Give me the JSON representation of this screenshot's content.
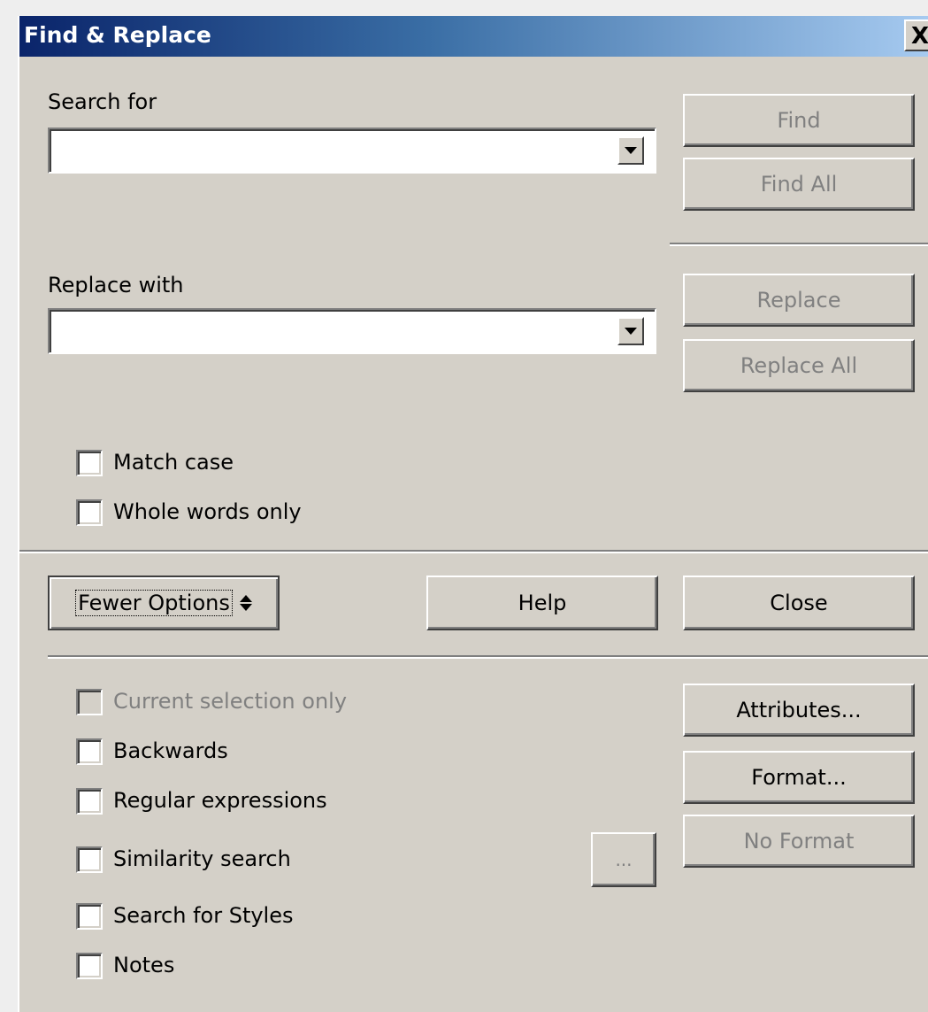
{
  "window": {
    "title": "Find & Replace",
    "close_glyph": "X"
  },
  "search": {
    "label": "Search for",
    "value": ""
  },
  "replace": {
    "label": "Replace with",
    "value": ""
  },
  "buttons": {
    "find": "Find",
    "find_all": "Find All",
    "replace": "Replace",
    "replace_all": "Replace All",
    "fewer_options": "Fewer Options",
    "help": "Help",
    "close": "Close",
    "attributes": "Attributes...",
    "format": "Format...",
    "no_format": "No Format",
    "similarity_dots": "..."
  },
  "options": {
    "match_case": "Match case",
    "whole_words": "Whole words only",
    "current_selection": "Current selection only",
    "backwards": "Backwards",
    "regex": "Regular expressions",
    "similarity": "Similarity search",
    "styles": "Search for Styles",
    "notes": "Notes"
  },
  "icons": {
    "combo_arrow": "chevron-down-icon",
    "options_toggle": "double-chevron-icon"
  }
}
